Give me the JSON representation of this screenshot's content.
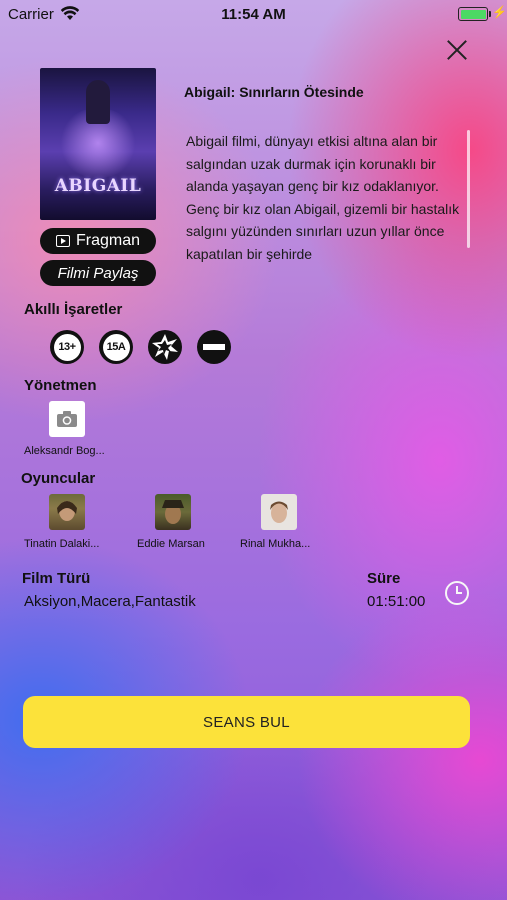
{
  "status_bar": {
    "carrier": "Carrier",
    "time": "11:54 AM",
    "battery_level": 1.0
  },
  "movie": {
    "title": "Abigail: Sınırların Ötesinde",
    "poster_title": "ABIGAIL",
    "description": "Abigail filmi, dünyayı etkisi altına alan bir salgından uzak durmak için korunaklı bir alanda yaşayan genç bir kız odaklanıyor. Genç bir kız olan Abigail, gizemli bir hastalık salgını yüzünden sınırları uzun yıllar önce kapatılan bir şehirde"
  },
  "buttons": {
    "trailer": "Fragman",
    "share": "Filmi Paylaş",
    "find_sessions": "SEANS BUL"
  },
  "smart_signs": {
    "heading": "Akıllı İşaretler",
    "badges": [
      {
        "label": "13+",
        "icon": "age-13-plus-icon"
      },
      {
        "label": "15A",
        "icon": "age-15a-icon"
      },
      {
        "label": "",
        "icon": "violence-icon"
      },
      {
        "label": "",
        "icon": "negative-content-icon"
      }
    ]
  },
  "director": {
    "heading": "Yönetmen",
    "name": "Aleksandr Bog...",
    "icon": "camera-placeholder-icon"
  },
  "cast": {
    "heading": "Oyuncular",
    "members": [
      {
        "name": "Tinatin Dalaki...",
        "colors": [
          "#6d6a3a",
          "#c49a78"
        ]
      },
      {
        "name": "Eddie Marsan",
        "colors": [
          "#4a5b2a",
          "#a07850"
        ]
      },
      {
        "name": "Rinal Mukha...",
        "colors": [
          "#e8e4e0",
          "#d7b39a"
        ]
      }
    ]
  },
  "details": {
    "genre_label": "Film Türü",
    "genre_value": "Aksiyon,Macera,Fantastik",
    "duration_label": "Süre",
    "duration_value": "01:51:00"
  },
  "colors": {
    "cta": "#fce23a",
    "pill": "#111111"
  }
}
